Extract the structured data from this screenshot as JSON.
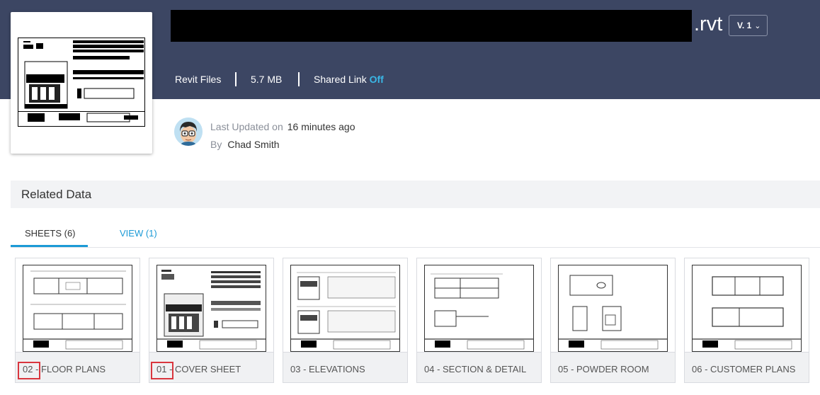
{
  "file": {
    "extension": ".rvt",
    "version": "V. 1",
    "type": "Revit Files",
    "size": "5.7 MB",
    "shared_link_label": "Shared Link",
    "shared_link_state": "Off"
  },
  "activity": {
    "updated_label": "Last Updated on",
    "updated_value": "16 minutes ago",
    "by_label": "By",
    "by_value": "Chad Smith"
  },
  "related": {
    "title": "Related Data",
    "tabs": [
      {
        "label": "SHEETS (6)",
        "active": true
      },
      {
        "label": "VIEW (1)",
        "active": false
      }
    ]
  },
  "sheets": [
    {
      "label": "02 - FLOOR PLANS"
    },
    {
      "label": "01 - COVER SHEET"
    },
    {
      "label": "03 - ELEVATIONS"
    },
    {
      "label": "04 - SECTION & DETAIL"
    },
    {
      "label": "05 - POWDER ROOM"
    },
    {
      "label": "06 - CUSTOMER PLANS"
    }
  ],
  "colors": {
    "header_bg": "#3c4663",
    "accent": "#1c9ad6",
    "link_off": "#3ab7e6",
    "highlight": "#d9363e"
  }
}
